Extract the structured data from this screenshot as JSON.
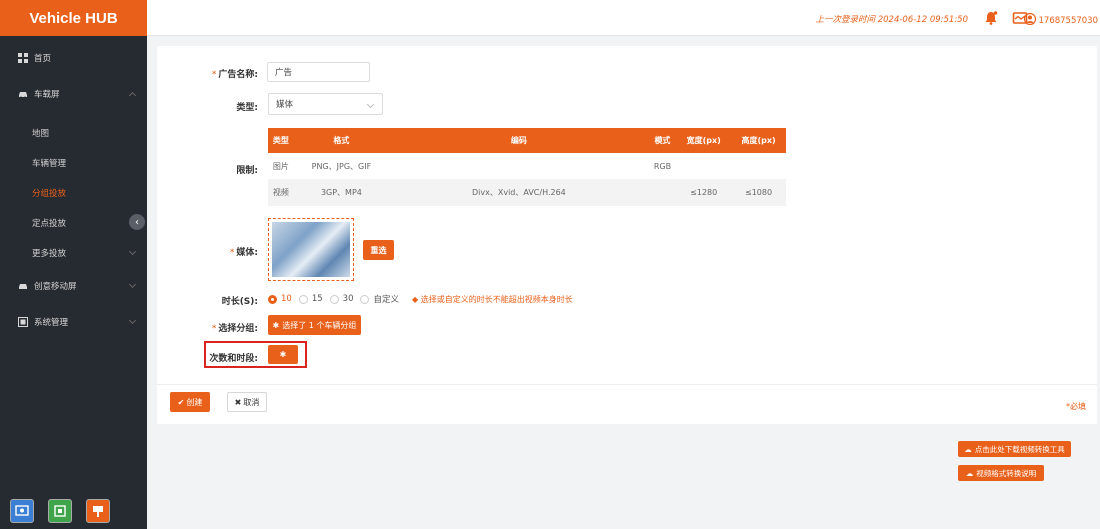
{
  "brand": "Vehicle HUB",
  "colors": {
    "accent": "#e8601a",
    "sidebar": "#262a31",
    "highlight": "#d9241f"
  },
  "sidebar": {
    "home": "首页",
    "car_screen": "车载屏",
    "sub": [
      "地图",
      "车辆管理",
      "分组投放",
      "定点投放",
      "更多投放"
    ],
    "creative_screen": "创意移动屏",
    "system": "系统管理"
  },
  "header": {
    "last_login": "上一次登录时间 2024-06-12 09:51:50",
    "user_id": "17687557030"
  },
  "form": {
    "ad_name_label": "广告名称:",
    "ad_name_value": "广告",
    "type_label": "类型:",
    "type_value": "媒体",
    "limits_label": "限制:",
    "limits_table": {
      "headers": [
        "类型",
        "格式",
        "编码",
        "模式",
        "宽度(px)",
        "高度(px)"
      ],
      "rows": [
        [
          "图片",
          "PNG、JPG、GIF",
          "",
          "RGB",
          "",
          ""
        ],
        [
          "视频",
          "3GP、MP4",
          "Divx、Xvid、AVC/H.264",
          "",
          "≤1280",
          "≤1080"
        ]
      ]
    },
    "media_label": "媒体:",
    "reselect": "重选",
    "duration_label": "时长(S):",
    "duration_options": [
      "10",
      "15",
      "30",
      "自定义"
    ],
    "duration_selected": "10",
    "duration_tip": "选择或自定义的时长不能超出视频本身时长",
    "group_label": "选择分组:",
    "group_button": "选择了 1 个车辆分组",
    "schedule_label": "次数和时段:",
    "create": "创建",
    "cancel": "取消",
    "required_note": "*必填"
  },
  "tools": {
    "download_tool": "点击此处下载视频转换工具",
    "format_guide": "视频格式转换说明"
  }
}
